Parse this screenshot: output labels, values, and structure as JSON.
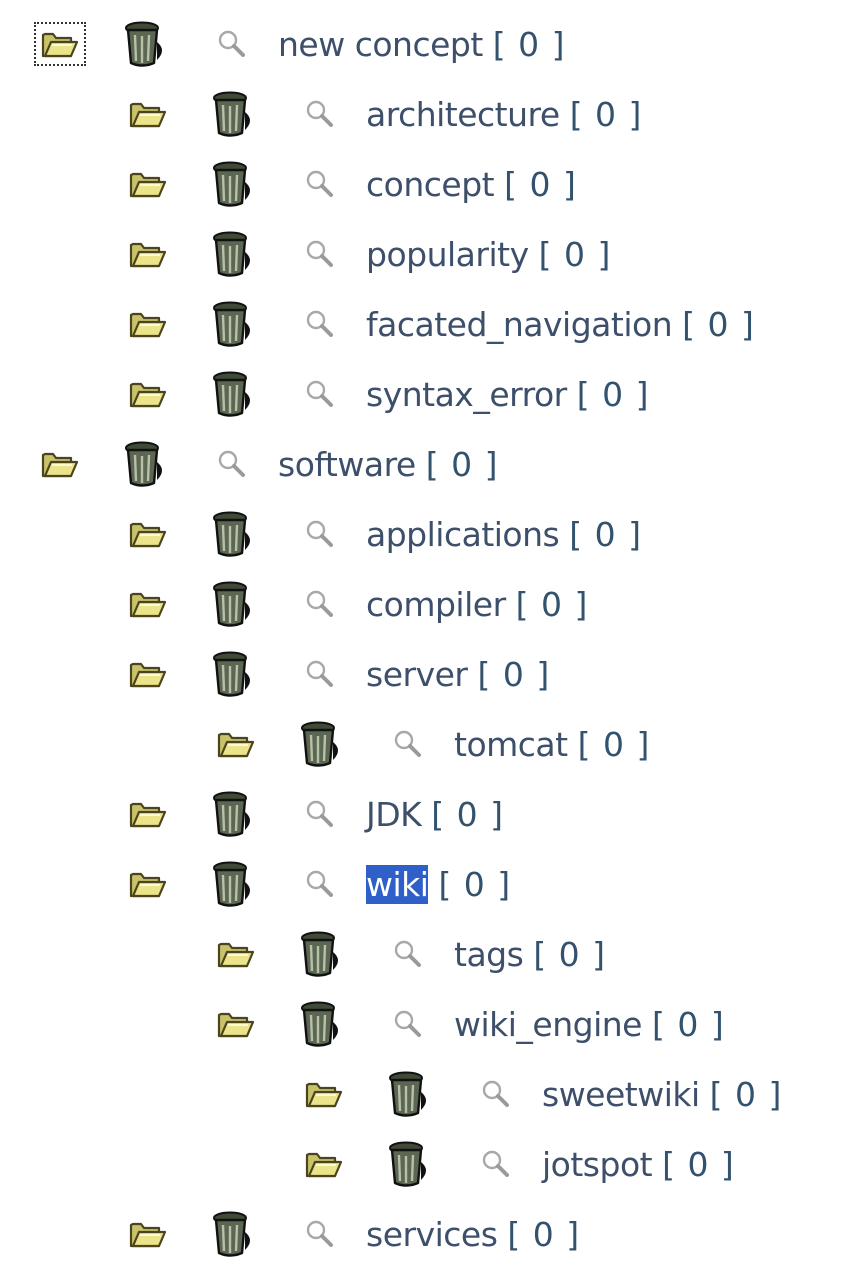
{
  "tree": {
    "nodes": [
      {
        "label": "new concept",
        "count": "[ 0 ]",
        "depth": 0,
        "focused": true
      },
      {
        "label": "architecture",
        "count": "[ 0 ]",
        "depth": 1
      },
      {
        "label": "concept",
        "count": "[ 0 ]",
        "depth": 1
      },
      {
        "label": "popularity",
        "count": "[ 0 ]",
        "depth": 1
      },
      {
        "label": "facated_navigation",
        "count": "[ 0 ]",
        "depth": 1
      },
      {
        "label": "syntax_error",
        "count": "[ 0 ]",
        "depth": 1
      },
      {
        "label": "software",
        "count": "[ 0 ]",
        "depth": 0
      },
      {
        "label": "applications",
        "count": "[ 0 ]",
        "depth": 1
      },
      {
        "label": "compiler",
        "count": "[ 0 ]",
        "depth": 1
      },
      {
        "label": "server",
        "count": "[ 0 ]",
        "depth": 1
      },
      {
        "label": "tomcat",
        "count": "[ 0 ]",
        "depth": 2
      },
      {
        "label": "JDK",
        "count": "[ 0 ]",
        "depth": 1
      },
      {
        "label": "wiki",
        "count": "[ 0 ]",
        "depth": 1,
        "selected": true
      },
      {
        "label": "tags",
        "count": "[ 0 ]",
        "depth": 2
      },
      {
        "label": "wiki_engine",
        "count": "[ 0 ]",
        "depth": 2
      },
      {
        "label": "sweetwiki",
        "count": "[ 0 ]",
        "depth": 3
      },
      {
        "label": "jotspot",
        "count": "[ 0 ]",
        "depth": 3
      },
      {
        "label": "services",
        "count": "[ 0 ]",
        "depth": 1
      }
    ]
  },
  "icons": {
    "folder": "folder-open-icon",
    "trash": "trash-can-icon",
    "search": "magnifier-icon"
  },
  "colors": {
    "label_text": "#3d4f6a",
    "selection_bg": "#2f5fc8",
    "selection_text": "#ffffff",
    "folder_fill": "#e8e07a",
    "trash_fill": "#56624f"
  }
}
